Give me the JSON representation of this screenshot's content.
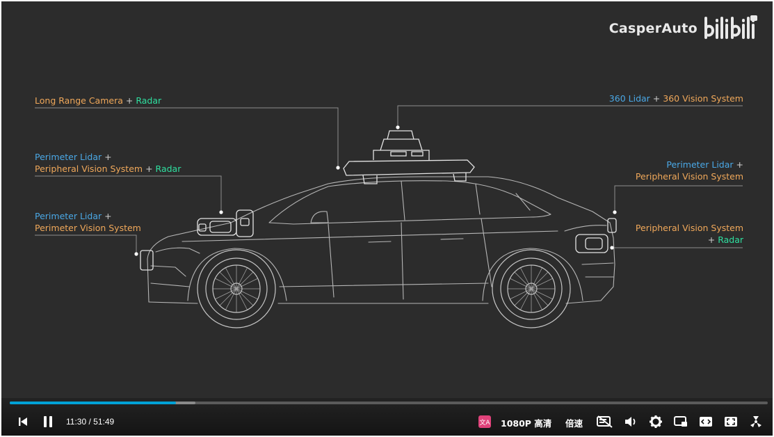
{
  "watermark": {
    "text": "CasperAuto",
    "logo": "bilibili"
  },
  "labels": {
    "long_range": {
      "camera": "Long Range Camera",
      "plus": "+",
      "radar": "Radar"
    },
    "perimeter1": {
      "lidar": "Perimeter Lidar",
      "plus1": "+",
      "pvs": "Peripheral Vision System",
      "plus2": "+",
      "radar": "Radar"
    },
    "perimeter2": {
      "lidar": "Perimeter Lidar",
      "plus": "+",
      "pvs": "Perimeter Vision System"
    },
    "lidar360": {
      "lidar": "360 Lidar",
      "plus": "+",
      "vision": "360 Vision System"
    },
    "right_perimeter": {
      "lidar": "Perimeter Lidar",
      "plus": "+",
      "pvs": "Peripheral Vision System"
    },
    "right_peripheral": {
      "pvs": "Peripheral Vision System",
      "plus": "+",
      "radar": "Radar"
    }
  },
  "player": {
    "progress": {
      "played_fraction": 0.219,
      "buffered_fraction": 0.245
    },
    "time_current": "11:30",
    "time_sep": "/",
    "time_total": "51:49",
    "quality": "1080P 高清",
    "speed": "倍速",
    "icons": [
      "prev-icon",
      "pause-icon",
      "subtitle-icon",
      "danmaku-off-icon",
      "volume-icon",
      "settings-icon",
      "pip-icon",
      "widescreen-icon",
      "web-fullscreen-icon",
      "fullscreen-icon"
    ]
  },
  "colors": {
    "accent": "#00a1d6",
    "blue": "#4aa8e6",
    "orange": "#f0a85a",
    "green": "#2fe0a0",
    "background": "#2c2c2c"
  }
}
